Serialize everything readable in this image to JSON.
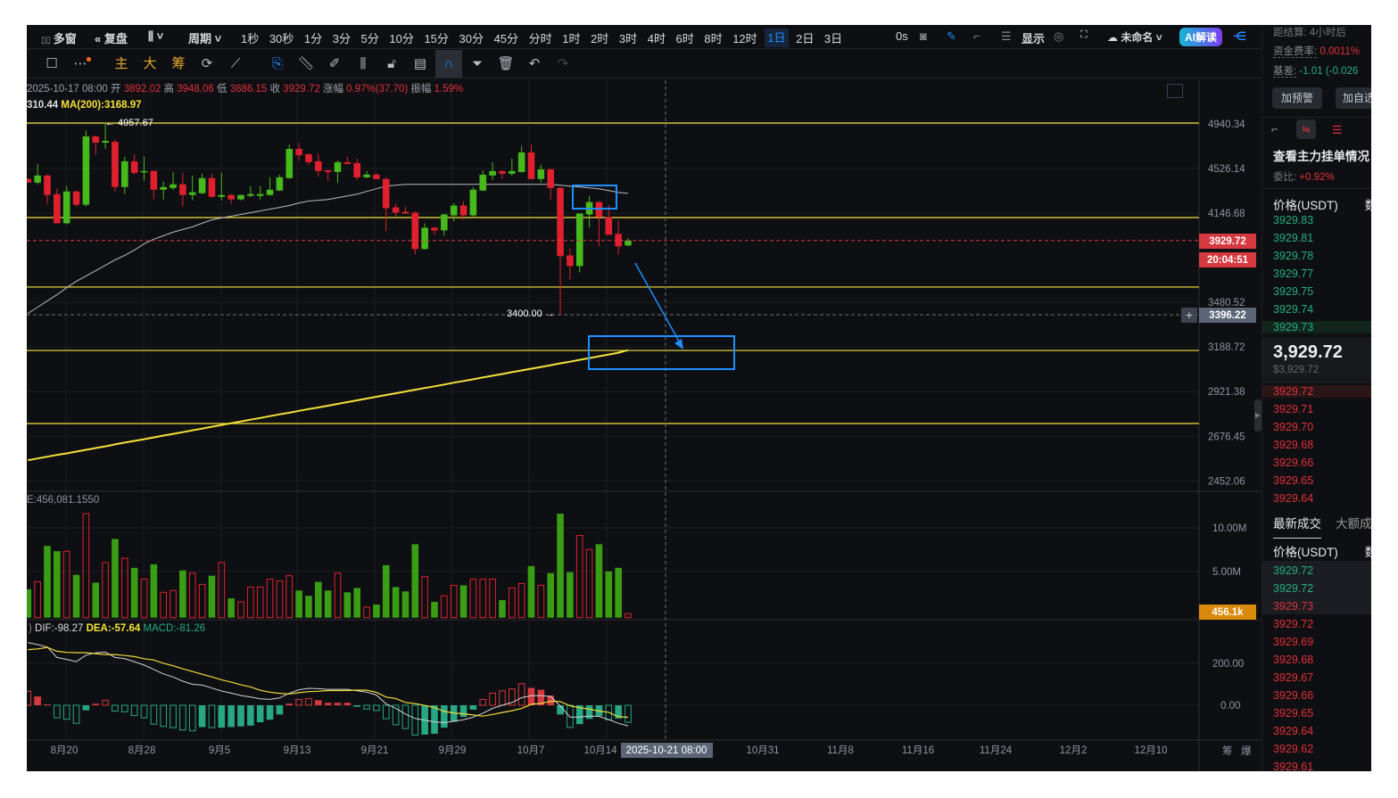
{
  "toolbar": {
    "multiwindow": "多窗",
    "replay": "复盘",
    "period": "周期",
    "periods": [
      "1秒",
      "30秒",
      "1分",
      "3分",
      "5分",
      "10分",
      "15分",
      "30分",
      "45分",
      "分时",
      "1时",
      "2时",
      "3时",
      "4时",
      "6时",
      "8时",
      "12时",
      "1日",
      "2日",
      "3日"
    ],
    "active_period": "1日",
    "countdown": "0s",
    "display": "显示",
    "layout_name": "未命名",
    "ai": "AI解读",
    "main": "主",
    "big": "大",
    "chips": "筹"
  },
  "info": {
    "datetime": "2025-10-17 08:00",
    "open_label": "开",
    "open": "3892.02",
    "high_label": "高",
    "high": "3948.06",
    "low_label": "低",
    "low": "3886.15",
    "close_label": "收",
    "close": "3929.72",
    "change_label": "涨幅",
    "change": "0.97%(37.70)",
    "amp_label": "振幅",
    "amp": "1.59%",
    "ma_value": "310.44",
    "ma200": "MA(200):3168.97"
  },
  "annotations": {
    "high_marker": "4957.67",
    "low_marker": "3400.00"
  },
  "price_axis": {
    "labels": [
      "4940.34",
      "4526.14",
      "4146.68",
      "3480.52",
      "3188.72",
      "2921.38",
      "2676.45",
      "2452.06"
    ],
    "current_price": "3929.72",
    "countdown": "20:04:51",
    "crosshair_price": "3396.22"
  },
  "volume": {
    "label": "E:456,081.1550",
    "axis": [
      "10.00M",
      "5.00M"
    ],
    "current": "456.1k"
  },
  "macd": {
    "dif_label": "DIF:-98.27",
    "dea_label": "DEA:-57.64",
    "macd_label": "MACD:-81.26",
    "axis": [
      "200.00",
      "0.00"
    ]
  },
  "time_axis": {
    "labels": [
      "8月20",
      "8月28",
      "9月5",
      "9月13",
      "9月21",
      "9月29",
      "10月7",
      "10月14",
      "2025-10-21 08:00",
      "10月31",
      "11月8",
      "11月16",
      "11月24",
      "12月2",
      "12月10"
    ],
    "right": [
      "筹",
      "爆"
    ]
  },
  "colors": {
    "up": "#46b91c",
    "down": "#e0202e",
    "accent": "#1e88ff",
    "level": "#f5e13b"
  },
  "chart_data": {
    "type": "candlestick",
    "ylim": [
      2452.06,
      4940.34
    ],
    "scale": "log",
    "ohlc": [
      [
        4434,
        4440,
        4403,
        4403
      ],
      [
        4403,
        4567,
        4388,
        4465
      ],
      [
        4465,
        4470,
        4223,
        4297
      ],
      [
        4305,
        4350,
        4065,
        4065
      ],
      [
        4065,
        4373,
        4058,
        4327
      ],
      [
        4327,
        4335,
        4200,
        4216
      ],
      [
        4216,
        4880,
        4201,
        4821
      ],
      [
        4821,
        4830,
        4655,
        4762
      ],
      [
        4762,
        4957.67,
        4704,
        4779
      ],
      [
        4770,
        4790,
        4327,
        4365
      ],
      [
        4365,
        4631,
        4305,
        4591
      ],
      [
        4591,
        4655,
        4472,
        4488
      ],
      [
        4496,
        4631,
        4419,
        4504
      ],
      [
        4504,
        4510,
        4260,
        4342
      ],
      [
        4342,
        4411,
        4260,
        4365
      ],
      [
        4357,
        4496,
        4340,
        4388
      ],
      [
        4388,
        4488,
        4201,
        4297
      ],
      [
        4297,
        4465,
        4253,
        4320
      ],
      [
        4312,
        4480,
        4305,
        4442
      ],
      [
        4442,
        4480,
        4275,
        4282
      ],
      [
        4282,
        4488,
        4253,
        4297
      ],
      [
        4297,
        4305,
        4223,
        4260
      ],
      [
        4260,
        4300,
        4250,
        4297
      ],
      [
        4290,
        4373,
        4280,
        4305
      ],
      [
        4290,
        4373,
        4260,
        4305
      ],
      [
        4297,
        4449,
        4290,
        4342
      ],
      [
        4335,
        4472,
        4330,
        4449
      ],
      [
        4442,
        4745,
        4435,
        4704
      ],
      [
        4704,
        4762,
        4598,
        4647
      ],
      [
        4655,
        4660,
        4559,
        4583
      ],
      [
        4591,
        4663,
        4457,
        4504
      ],
      [
        4511,
        4515,
        4419,
        4496
      ],
      [
        4496,
        4598,
        4403,
        4583
      ],
      [
        4583,
        4631,
        4560,
        4567
      ],
      [
        4575,
        4615,
        4426,
        4449
      ],
      [
        4449,
        4504,
        4440,
        4472
      ],
      [
        4472,
        4488,
        4430,
        4434
      ],
      [
        4434,
        4449,
        4002,
        4187
      ],
      [
        4194,
        4223,
        4122,
        4151
      ],
      [
        4158,
        4201,
        4140,
        4144
      ],
      [
        4151,
        4160,
        3824,
        3865
      ],
      [
        3865,
        4065,
        3860,
        4030
      ],
      [
        4030,
        4035,
        3974,
        4009
      ],
      [
        4009,
        4140,
        3967,
        4136
      ],
      [
        4129,
        4230,
        4080,
        4209
      ],
      [
        4209,
        4245,
        4093,
        4129
      ],
      [
        4129,
        4365,
        4120,
        4342
      ],
      [
        4335,
        4511,
        4330,
        4472
      ],
      [
        4465,
        4583,
        4426,
        4504
      ],
      [
        4504,
        4510,
        4434,
        4480
      ],
      [
        4480,
        4615,
        4465,
        4504
      ],
      [
        4496,
        4730,
        4490,
        4671
      ],
      [
        4671,
        4745,
        4430,
        4434
      ],
      [
        4434,
        4559,
        4403,
        4519
      ],
      [
        4519,
        4525,
        4260,
        4357
      ],
      [
        4357,
        4365,
        3400,
        3811
      ],
      [
        3817,
        3870,
        3642,
        3738
      ],
      [
        3738,
        4144,
        3693,
        4144
      ],
      [
        4136,
        4290,
        4030,
        4238
      ],
      [
        4238,
        4245,
        3885,
        4115
      ],
      [
        4115,
        4216,
        4100,
        3974
      ],
      [
        3981,
        4086,
        3824,
        3885
      ],
      [
        3892.02,
        3948.06,
        3886.15,
        3929.72
      ]
    ],
    "ma": [
      3406,
      3448,
      3491,
      3533,
      3582,
      3627,
      3665,
      3704,
      3743,
      3783,
      3817,
      3857,
      3905,
      3940,
      3967,
      3995,
      4016,
      4037,
      4065,
      4093,
      4108,
      4122,
      4136,
      4151,
      4165,
      4180,
      4194,
      4209,
      4231,
      4246,
      4253,
      4260,
      4275,
      4290,
      4305,
      4327,
      4350,
      4373,
      4380,
      4388,
      4388,
      4388,
      4388,
      4388,
      4388,
      4388,
      4388,
      4388,
      4388,
      4388,
      4388,
      4388,
      4388,
      4388,
      4388,
      4380,
      4373,
      4365,
      4357,
      4350,
      4335,
      4320,
      4310.44
    ],
    "ma200": [
      2553,
      2562,
      2571,
      2580,
      2588,
      2597,
      2606,
      2615,
      2624,
      2634,
      2643,
      2652,
      2661,
      2670,
      2680,
      2689,
      2698,
      2708,
      2717,
      2727,
      2736,
      2746,
      2755,
      2765,
      2774,
      2784,
      2794,
      2803,
      2813,
      2823,
      2832,
      2842,
      2852,
      2862,
      2872,
      2882,
      2892,
      2902,
      2912,
      2922,
      2932,
      2942,
      2952,
      2962,
      2973,
      2983,
      2993,
      3004,
      3014,
      3024,
      3035,
      3045,
      3056,
      3066,
      3077,
      3088,
      3098,
      3109,
      3120,
      3131,
      3142,
      3153,
      3168.97
    ],
    "volume_m": [
      3.25,
      4.1,
      8.2,
      7.6,
      7.6,
      4.9,
      11.9,
      4.0,
      6.3,
      9.0,
      6.8,
      5.7,
      4.4,
      6.1,
      2.9,
      3.1,
      5.4,
      5.1,
      3.8,
      4.8,
      6.3,
      2.2,
      1.8,
      3.5,
      3.5,
      4.4,
      4.2,
      4.8,
      3.1,
      2.5,
      4.1,
      3.1,
      5.1,
      2.9,
      3.4,
      1.2,
      1.5,
      6.0,
      3.5,
      3.0,
      8.4,
      4.7,
      1.8,
      2.5,
      3.7,
      3.7,
      4.4,
      4.4,
      4.4,
      2.0,
      3.4,
      3.9,
      5.9,
      3.7,
      5.1,
      11.9,
      5.2,
      9.4,
      7.8,
      8.4,
      5.3,
      5.7,
      0.456
    ],
    "volume_up": [
      1,
      0,
      1,
      1,
      0,
      1,
      0,
      1,
      0,
      1,
      0,
      1,
      0,
      1,
      0,
      0,
      1,
      0,
      0,
      1,
      0,
      1,
      0,
      0,
      0,
      0,
      0,
      0,
      1,
      1,
      1,
      1,
      0,
      1,
      1,
      0,
      1,
      1,
      1,
      1,
      1,
      0,
      1,
      0,
      0,
      1,
      0,
      0,
      0,
      1,
      0,
      0,
      1,
      0,
      1,
      1,
      1,
      0,
      0,
      1,
      1,
      1,
      0
    ],
    "dif": [
      299,
      290,
      278,
      228,
      219,
      208,
      239,
      250,
      254,
      228,
      222,
      208,
      192,
      171,
      150,
      135,
      115,
      100,
      96,
      82,
      68,
      58,
      47,
      39,
      31,
      28,
      35,
      58,
      74,
      81,
      79,
      76,
      76,
      76,
      69,
      63,
      49,
      7,
      -14,
      -42,
      -63,
      -71,
      -79,
      -83,
      -76,
      -69,
      -57,
      -38,
      -15,
      0,
      13,
      36,
      46,
      46,
      42,
      -4,
      -56,
      -56,
      -51,
      -53,
      -68,
      -86,
      -98.27
    ],
    "macd_hist": [
      67,
      42,
      4,
      -60,
      -67,
      -86,
      -24,
      7,
      24,
      -28,
      -31,
      -49,
      -60,
      -90,
      -101,
      -107,
      -118,
      -122,
      -104,
      -107,
      -107,
      -104,
      -101,
      -97,
      -81,
      -69,
      -44,
      8,
      28,
      32,
      24,
      12,
      12,
      12,
      -7,
      -18,
      -25,
      -64,
      -93,
      -111,
      -142,
      -140,
      -136,
      -107,
      -79,
      -56,
      -21,
      28,
      58,
      69,
      78,
      103,
      83,
      74,
      46,
      -44,
      -106,
      -90,
      -65,
      -51,
      -69,
      -63,
      -81.26
    ],
    "levels": [
      4949,
      4111,
      3587,
      3167,
      2744
    ]
  },
  "panel": {
    "settle_label": "距结算:",
    "settle": "4小时后",
    "funding_label": "资金费率:",
    "funding": "0.0011%",
    "basis_label": "基差:",
    "basis": "-1.01 (-0.026",
    "alert": "加预警",
    "watch": "加自选",
    "whale": "查看主力挂单情况",
    "ratio_label": "委比:",
    "ratio": "+0.92%",
    "price_header": "价格(USDT)",
    "qty_header": "数",
    "asks": [
      "3929.83",
      "3929.81",
      "3929.78",
      "3929.77",
      "3929.75",
      "3929.74",
      "3929.73"
    ],
    "mid": "3,929.72",
    "mid_usd": "$3,929.72",
    "bids": [
      "3929.72",
      "3929.71",
      "3929.70",
      "3929.68",
      "3929.66",
      "3929.65",
      "3929.64"
    ],
    "trades_tab": "最新成交",
    "large_tab": "大额成",
    "trades_header": "价格(USDT)",
    "trades": [
      {
        "p": "3929.72",
        "up": true
      },
      {
        "p": "3929.72",
        "up": true
      },
      {
        "p": "3929.73",
        "up": false
      },
      {
        "p": "3929.72",
        "up": false
      },
      {
        "p": "3929.69",
        "up": false
      },
      {
        "p": "3929.68",
        "up": false
      },
      {
        "p": "3929.67",
        "up": false
      },
      {
        "p": "3929.66",
        "up": false
      },
      {
        "p": "3929.65",
        "up": false
      },
      {
        "p": "3929.64",
        "up": false
      },
      {
        "p": "3929.62",
        "up": false
      },
      {
        "p": "3929.61",
        "up": false
      }
    ]
  }
}
